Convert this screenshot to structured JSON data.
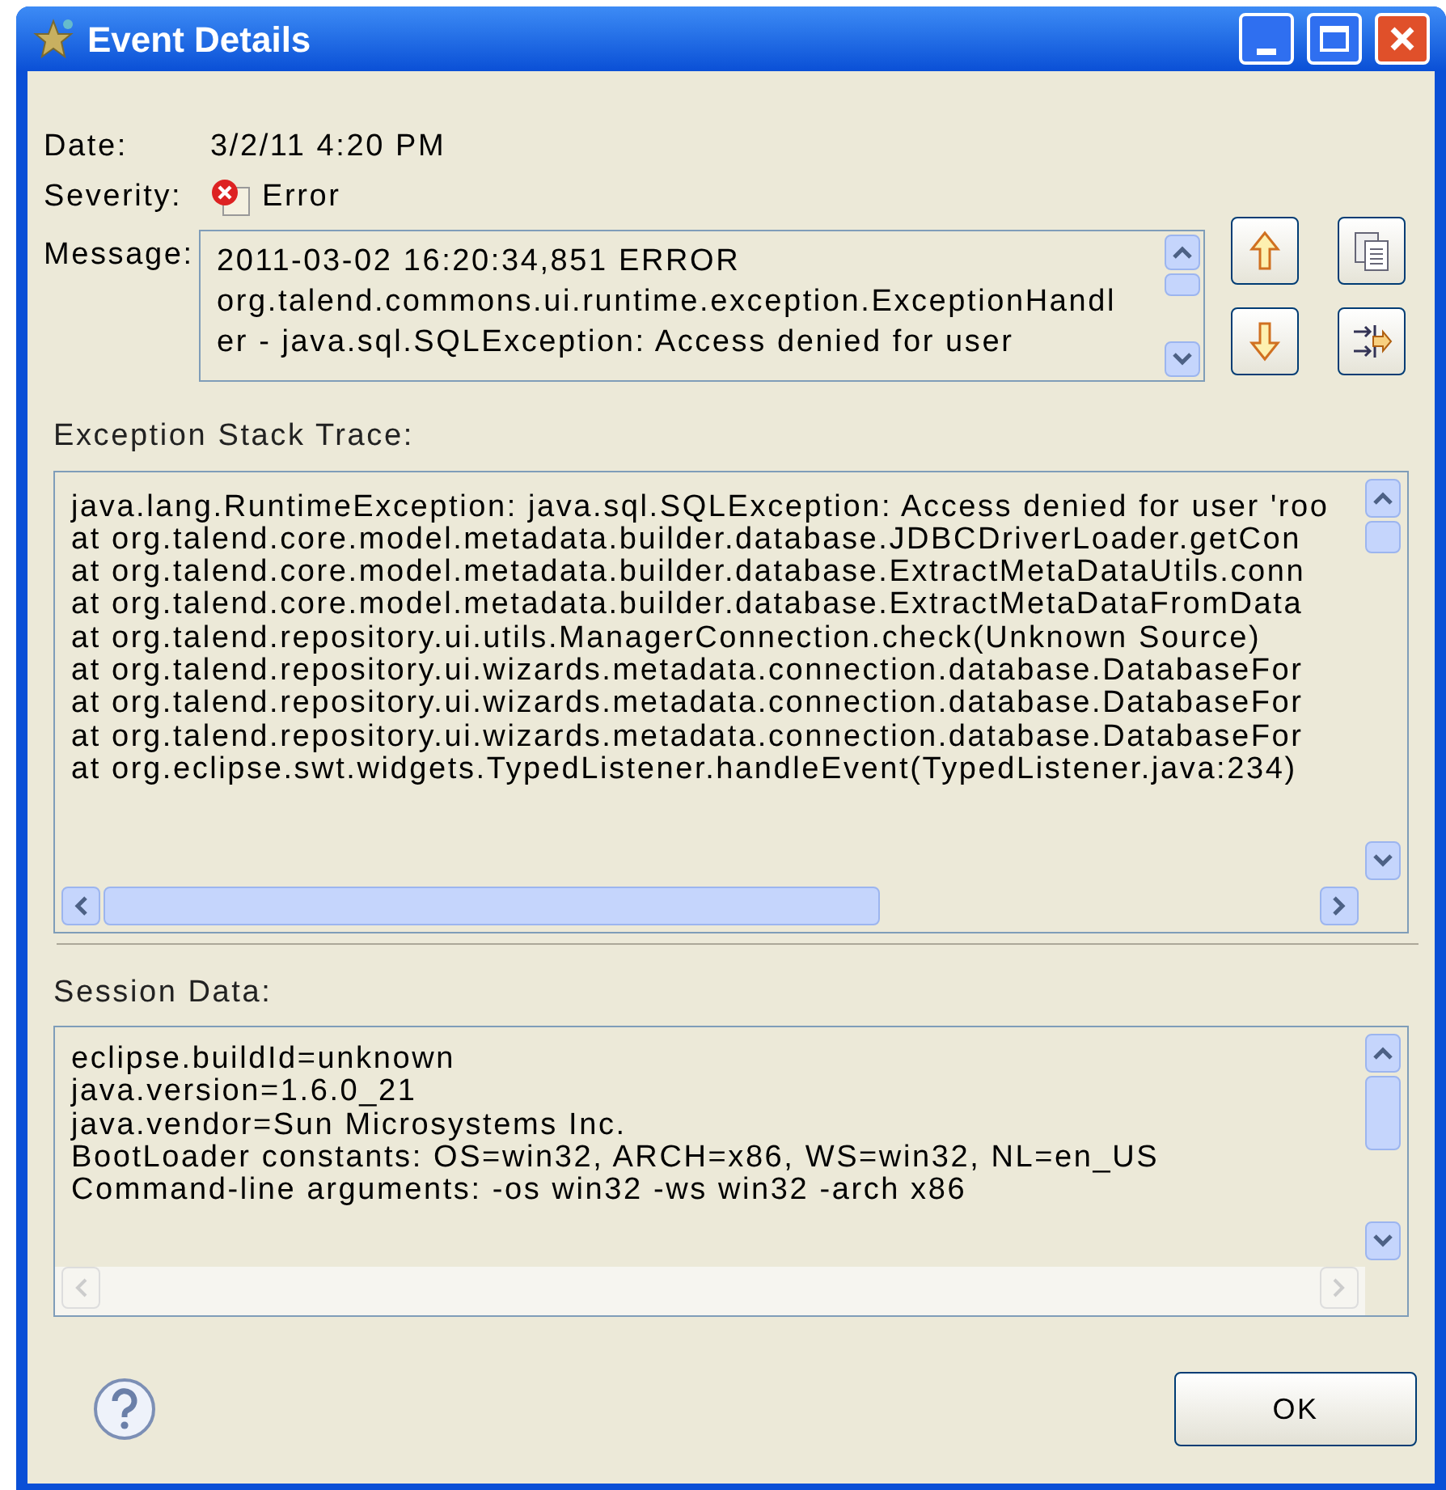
{
  "window": {
    "title": "Event Details"
  },
  "date": {
    "label": "Date:",
    "value": "3/2/11 4:20 PM"
  },
  "severity": {
    "label": "Severity:",
    "value": "Error"
  },
  "message": {
    "label": "Message:",
    "lines": [
      "2011-03-02 16:20:34,851 ERROR",
      "org.talend.commons.ui.runtime.exception.ExceptionHandl",
      "er  - java.sql.SQLException: Access denied for user"
    ]
  },
  "stack_trace": {
    "label": "Exception Stack Trace:",
    "lines": [
      "java.lang.RuntimeException: java.sql.SQLException: Access denied for user 'roo",
      "at org.talend.core.model.metadata.builder.database.JDBCDriverLoader.getCon",
      "at org.talend.core.model.metadata.builder.database.ExtractMetaDataUtils.conn",
      "at org.talend.core.model.metadata.builder.database.ExtractMetaDataFromData",
      "at org.talend.repository.ui.utils.ManagerConnection.check(Unknown Source)",
      "at org.talend.repository.ui.wizards.metadata.connection.database.DatabaseFor",
      "at org.talend.repository.ui.wizards.metadata.connection.database.DatabaseFor",
      "at org.talend.repository.ui.wizards.metadata.connection.database.DatabaseFor",
      "at org.eclipse.swt.widgets.TypedListener.handleEvent(TypedListener.java:234)"
    ]
  },
  "session_data": {
    "label": "Session Data:",
    "lines": [
      "eclipse.buildId=unknown",
      "java.version=1.6.0_21",
      "java.vendor=Sun Microsystems Inc.",
      "BootLoader constants: OS=win32, ARCH=x86, WS=win32, NL=en_US",
      "Command-line arguments:  -os win32 -ws win32 -arch x86"
    ]
  },
  "buttons": [
    "OK"
  ]
}
